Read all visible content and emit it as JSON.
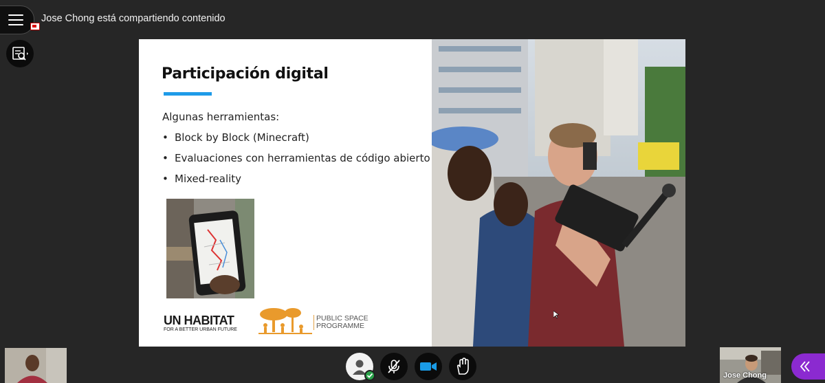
{
  "header": {
    "share_banner": "Jose Chong está compartiendo contenido"
  },
  "slide": {
    "title": "Participación digital",
    "intro": "Algunas herramientas:",
    "bullets": [
      "Block by Block (Minecraft)",
      "Evaluaciones con herramientas de código abierto",
      "Mixed-reality"
    ],
    "logo_unhabitat": {
      "main": "UN HABITAT",
      "tagline": "FOR A BETTER URBAN FUTURE"
    },
    "logo_psp": {
      "line1": "PUBLIC SPACE",
      "line2": "PROGRAMME"
    }
  },
  "participants": {
    "speaker_name": "Jose Chong"
  },
  "controls": {
    "avatar_icon": "user-avatar-icon",
    "mic_icon": "mic-muted-icon",
    "camera_icon": "video-camera-icon",
    "hand_icon": "raise-hand-icon",
    "collapse_icon": "double-chevron-left-icon"
  },
  "colors": {
    "background": "#262626",
    "accent_rule": "#1e9be8",
    "camera_blue": "#1a9be6",
    "collapse_purple": "#8b2ad0",
    "status_green": "#2aa24a",
    "psp_orange": "#e2a145"
  }
}
